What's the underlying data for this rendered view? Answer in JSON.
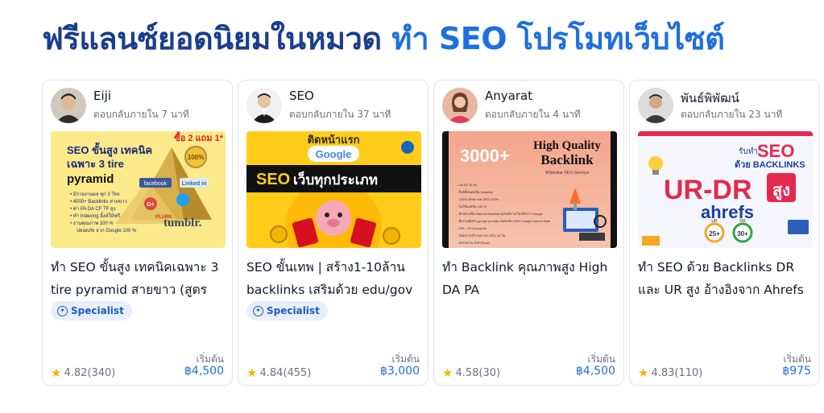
{
  "heading": {
    "dark": "ฟรีแลนซ์ยอดนิยมในหมวด",
    "blue": "ทำ SEO โปรโมทเว็บไซต์"
  },
  "cards": [
    {
      "seller": "Eiji",
      "response": "ตอบกลับภายใน 7 นาที",
      "title": "ทำ SEO ขั้นสูง เทคนิคเฉพาะ 3 tire pyramid สายขาว (สูตร",
      "badge": "Specialist",
      "start_label": "เริ่มต้น",
      "rating": "4.82(340)",
      "price": "฿4,500",
      "thumb": {
        "promo": "ซื้อ 2 แถม 1*",
        "line1": "SEO ขั้นสูง เทคนิค",
        "line2": "เฉพาะ 3 tire",
        "line3": "pyramid",
        "b1": "• มีรายงานผล ทุก 3 Tire",
        "b2": "• 4000+ Backlinks สายขาว",
        "b3": "• ค่า PA DA CF TF สูง",
        "b4": "• ทำ Indexing ลิ้งค์ให้ฟรี",
        "b5": "• งานคุณภาพ 100 %",
        "b6": "ปลอดภัย จาก Google 100 %",
        "seal": "100%",
        "facebook": "facebook",
        "linkedin": "Linked in",
        "gplus": "G+",
        "plurk": "PLURK",
        "tumblr": "tumblr."
      }
    },
    {
      "seller": "SEO",
      "response": "ตอบกลับภายใน 37 นาที",
      "title": "SEO ขั้นเทพ | สร้าง1-10ล้าน backlinks เสริมด้วย edu/gov",
      "badge": "Specialist",
      "start_label": "เริ่มต้น",
      "rating": "4.84(455)",
      "price": "฿3,000",
      "thumb": {
        "top": "ติดหน้าแรก",
        "google": "Google",
        "banner_seo": "SEO",
        "banner_rest": "เว็บทุกประเภท"
      }
    },
    {
      "seller": "Anyarat",
      "response": "ตอบกลับภายใน 4 นาที",
      "title": "ทำ Backlink คุณภาพสูง High DA PA",
      "badge": "",
      "start_label": "เริ่มต้น",
      "rating": "4.58(30)",
      "price": "฿4,500",
      "thumb": {
        "big": "3000+",
        "hq": "High Quality",
        "backlink": "Backlink",
        "sub": "Whitehat SEO Service",
        "l1": "- DA PA 30-90",
        "l2": "- ลิ้งค์ทั้งหมดเป็น Dofollow",
        "l3": "- 100% White Hat SEO 100%",
        "l4": "- ไม่ใช้บอทปั่น 100 %",
        "l5": "- ทำอย่างเป็น Natural Backlink ทุกลิงค์จากเว็บจริงจาก Google",
        "l6": "- ทีมงานคุ้มกับ google penalty ปลอดภัย 100% Google Animal Safe",
        "l7": "- URL / 10 Keywords",
        "l8": "- ส่งผลรวดเร็ว/ส่งงานภายใน 14 วัน",
        "l9": "- ส่งรายงาน PDF/Excel"
      }
    },
    {
      "seller": "พันธ์พิพัฒน์",
      "response": "ตอบกลับภายใน 23 นาที",
      "title": "ทำ SEO ด้วย Backlinks DR และ UR สูง อ้างอิงจาก Ahrefs",
      "badge": "",
      "start_label": "เริ่มต้น",
      "rating": "4.83(110)",
      "price": "฿975",
      "thumb": {
        "t1": "รับทำ",
        "t2": "SEO",
        "t3": "ด้วย BACKLINKS",
        "urdr": "UR-DR",
        "sung": "สูง",
        "ahrefs": "ahrefs",
        "c1": "25+",
        "c2": "30+",
        "c1_label": "UR",
        "c2_label": "DR"
      }
    }
  ],
  "colors": {
    "heading_dark": "#1a3d8f",
    "heading_blue": "#1e6fe0",
    "price": "#1e6fe0",
    "star": "#f5b500",
    "badge_bg": "#e8effb"
  },
  "icons": [
    "star-icon",
    "specialist-icon"
  ]
}
